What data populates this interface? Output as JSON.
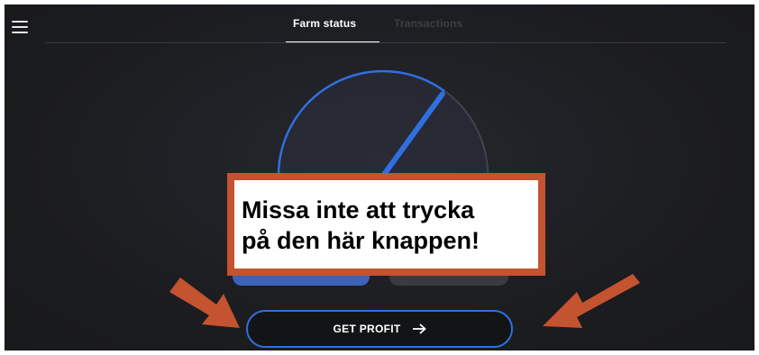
{
  "header": {
    "tabs": [
      {
        "label": "Farm status",
        "active": true
      },
      {
        "label": "Transactions",
        "active": false
      }
    ]
  },
  "gauge": {
    "fraction": 0.7,
    "accent_color": "#2f6fe0",
    "track_color": "#4a4c51"
  },
  "annotation": {
    "line1": "Missa inte att trycka",
    "line2": "på den här knappen!",
    "border_color": "#c4532f"
  },
  "profit_button": {
    "label": "GET PROFIT",
    "icon": "arrow-right-icon"
  },
  "colors": {
    "background": "#1c1d20",
    "accent": "#2f6fe0",
    "arrow": "#c4532f"
  }
}
